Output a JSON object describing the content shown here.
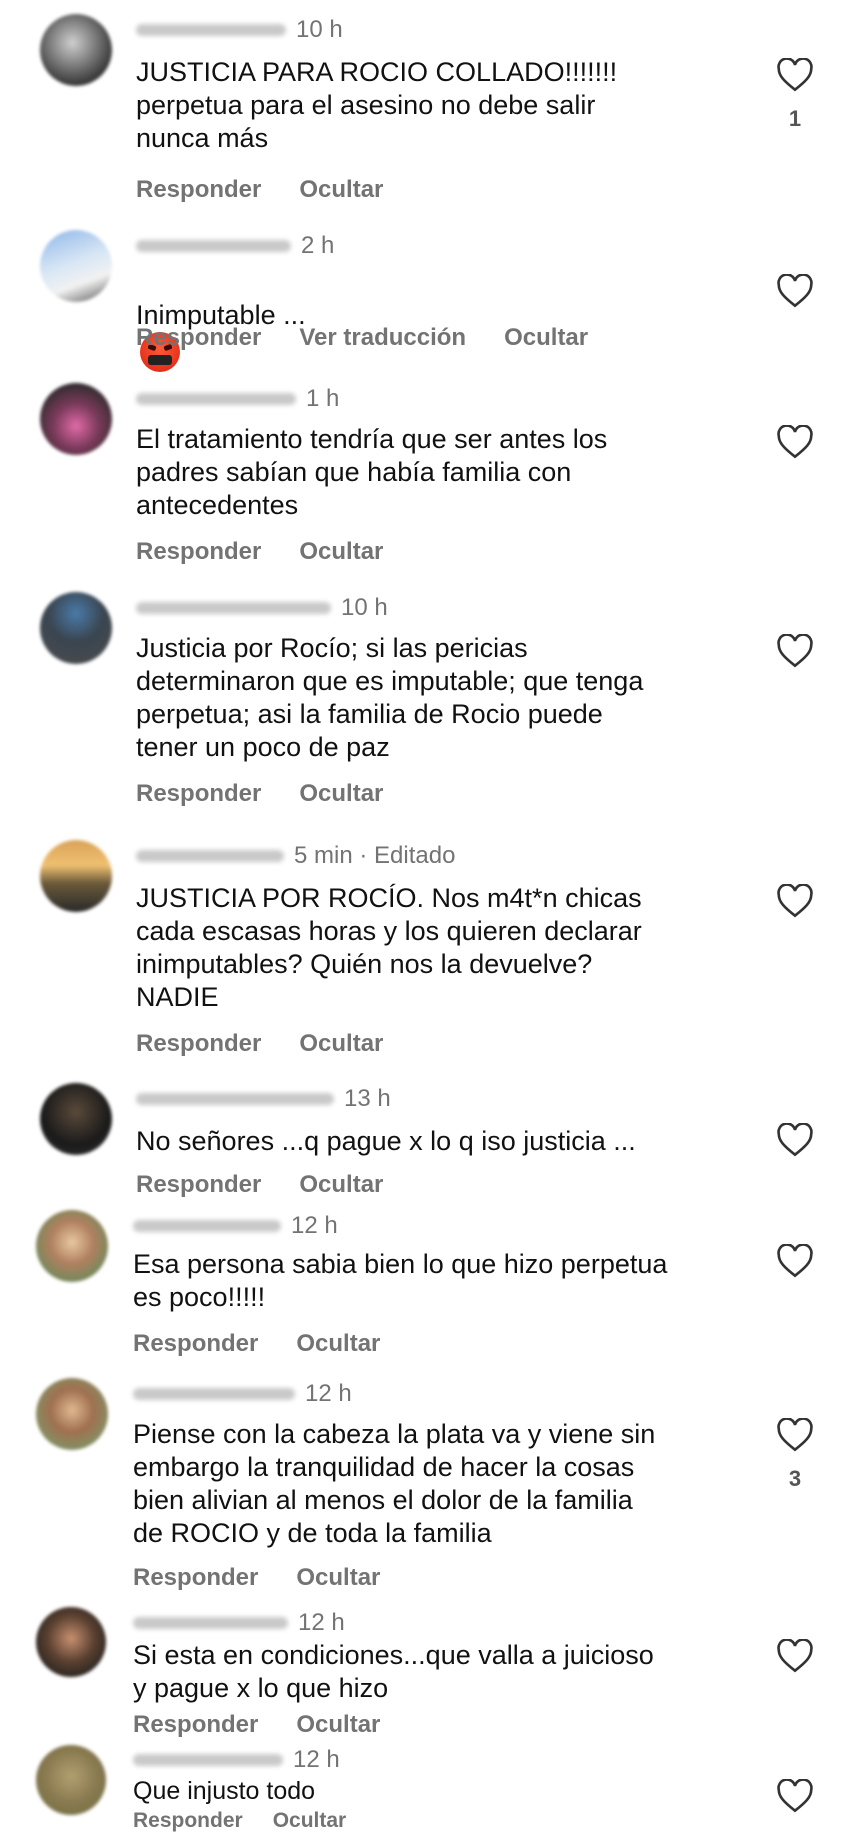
{
  "like_icon": "heart-outline-icon",
  "colors": {
    "text": "#111111",
    "secondary": "#737373",
    "background": "#ffffff"
  },
  "comments": [
    {
      "time": "10 h",
      "text": "JUSTICIA PARA ROCIO COLLADO!!!!!!!\nperpetua para el asesino no debe salir\nnunca más",
      "actions": [
        "Responder",
        "Ocultar"
      ],
      "likes": "1"
    },
    {
      "time": "2 h",
      "text": "Inimputable ...",
      "emoji": "enraged-face-with-symbols-emoji",
      "actions": [
        "Responder",
        "Ver traducción",
        "Ocultar"
      ],
      "likes": ""
    },
    {
      "time": "1 h",
      "text": "El tratamiento tendría que ser antes los\npadres sabían que había familia con\nantecedentes",
      "actions": [
        "Responder",
        "Ocultar"
      ],
      "likes": ""
    },
    {
      "time": "10 h",
      "text": "Justicia por Rocío; si las pericias\ndeterminaron que es imputable; que tenga\nperpetua; asi la familia de Rocio puede\ntener un poco de paz",
      "actions": [
        "Responder",
        "Ocultar"
      ],
      "likes": ""
    },
    {
      "time": "5 min · Editado",
      "text": "JUSTICIA POR ROCÍO. Nos m4t*n chicas\ncada escasas horas y los quieren declarar\ninimputables? Quién nos la devuelve?\nNADIE",
      "actions": [
        "Responder",
        "Ocultar"
      ],
      "likes": ""
    },
    {
      "time": "13 h",
      "text": "No señores ...q pague x lo q iso justicia ...",
      "actions": [
        "Responder",
        "Ocultar"
      ],
      "likes": ""
    },
    {
      "time": "12 h",
      "text": "Esa persona sabia bien lo que hizo perpetua\nes poco!!!!!",
      "actions": [
        "Responder",
        "Ocultar"
      ],
      "likes": ""
    },
    {
      "time": "12 h",
      "text": "Piense con la cabeza la plata va y viene sin\nembargo la tranquilidad de hacer la cosas\nbien alivian  al menos el dolor de la familia\nde ROCIO y de toda la familia",
      "actions": [
        "Responder",
        "Ocultar"
      ],
      "likes": "3"
    },
    {
      "time": "12 h",
      "text": "Si esta en condiciones...que valla a juicioso\ny pague x lo que hizo",
      "actions": [
        "Responder",
        "Ocultar"
      ],
      "likes": ""
    },
    {
      "time": "12 h",
      "text": "Que injusto todo",
      "actions": [
        "Responder",
        "Ocultar"
      ],
      "likes": ""
    }
  ]
}
